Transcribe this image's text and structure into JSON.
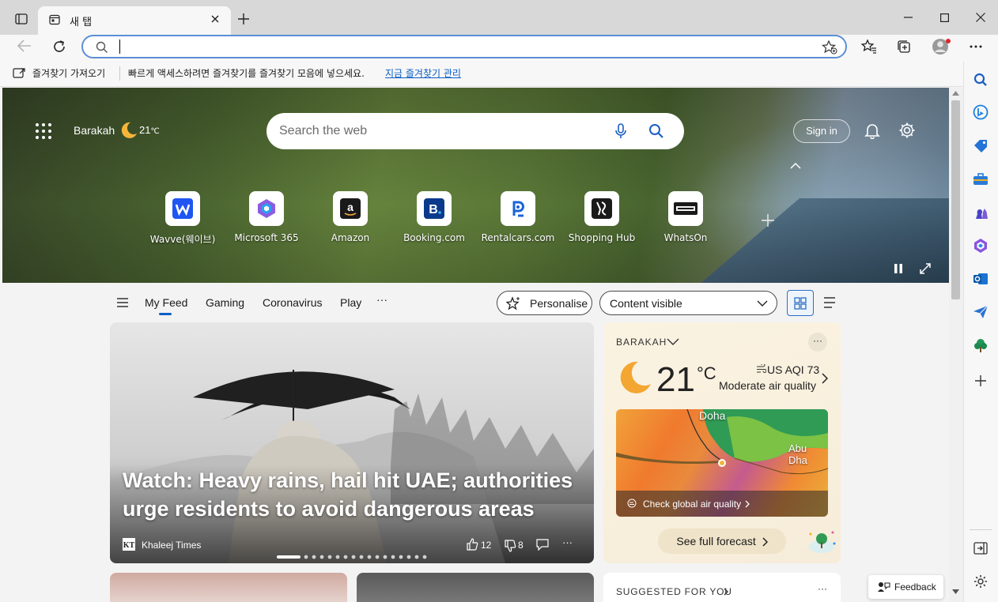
{
  "tab": {
    "title": "새 탭"
  },
  "address": {
    "value": ""
  },
  "favorites_bar": {
    "import_label": "즐겨찾기 가져오기",
    "hint": "빠르게 액세스하려면 즐겨찾기를 즐겨찾기 모음에 넣으세요.",
    "manage_link": "지금 즐겨찾기 관리"
  },
  "hero": {
    "location": "Barakah",
    "temp": "21",
    "temp_unit": "℃",
    "search_placeholder": "Search the web",
    "signin_label": "Sign in"
  },
  "quick_links": [
    {
      "name": "Wavve(웨이브)",
      "icon": "wavve-icon"
    },
    {
      "name": "Microsoft 365",
      "icon": "microsoft365-icon"
    },
    {
      "name": "Amazon",
      "icon": "amazon-icon"
    },
    {
      "name": "Booking.com",
      "icon": "booking-icon"
    },
    {
      "name": "Rentalcars.com",
      "icon": "rentalcars-icon"
    },
    {
      "name": "Shopping Hub",
      "icon": "shopping-hub-icon"
    },
    {
      "name": "WhatsOn",
      "icon": "whatson-icon"
    }
  ],
  "feed_nav": {
    "tabs": [
      "My Feed",
      "Gaming",
      "Coronavirus",
      "Play"
    ],
    "more": "···",
    "personalise": "Personalise",
    "content_visible": "Content visible"
  },
  "main_card": {
    "headline": "Watch: Heavy rains, hail hit UAE; authorities urge residents to avoid dangerous areas",
    "source": "Khaleej Times",
    "likes": "12",
    "dislikes": "8",
    "more": "···"
  },
  "weather": {
    "location": "BARAKAH",
    "temp": "21",
    "unit": "°C",
    "aqi": "US AQI 73",
    "aqi_desc": "Moderate air quality",
    "map_city1": "Doha",
    "map_city2": "Abu Dha",
    "air_link": "Check global air quality",
    "forecast": "See full forecast",
    "more": "···"
  },
  "suggested": {
    "title": "SUGGESTED FOR YOU",
    "more": "···"
  },
  "feedback": {
    "label": "Feedback"
  },
  "colors": {
    "accent": "#0b5ec7",
    "address_border": "#5b8fd6"
  }
}
